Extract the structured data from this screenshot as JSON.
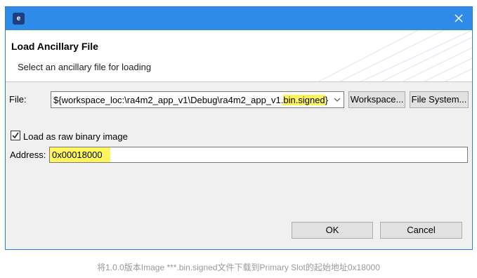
{
  "window": {
    "app_icon": "eclipse-e-icon",
    "close_icon": "close-icon"
  },
  "banner": {
    "title": "Load Ancillary File",
    "message": "Select an ancillary file for loading"
  },
  "file": {
    "label": "File:",
    "value_prefix": "${workspace_loc:\\ra4m2_app_v1\\Debug\\ra4m2_app_v1.",
    "value_highlight": "bin.signed",
    "value_suffix": "}",
    "workspace_button": "Workspace...",
    "filesystem_button": "File System..."
  },
  "raw_binary": {
    "label": "Load as raw binary image",
    "checked": true
  },
  "address": {
    "label": "Address:",
    "value": "0x00018000"
  },
  "buttons": {
    "ok": "OK",
    "cancel": "Cancel"
  },
  "caption": "将1.0.0版本Image ***.bin.signed文件下载到Primary Slot的起始地址0x18000",
  "colors": {
    "titlebar": "#2e8ce8",
    "highlight": "#fef55c",
    "dialog_bg": "#f0f0f0"
  }
}
